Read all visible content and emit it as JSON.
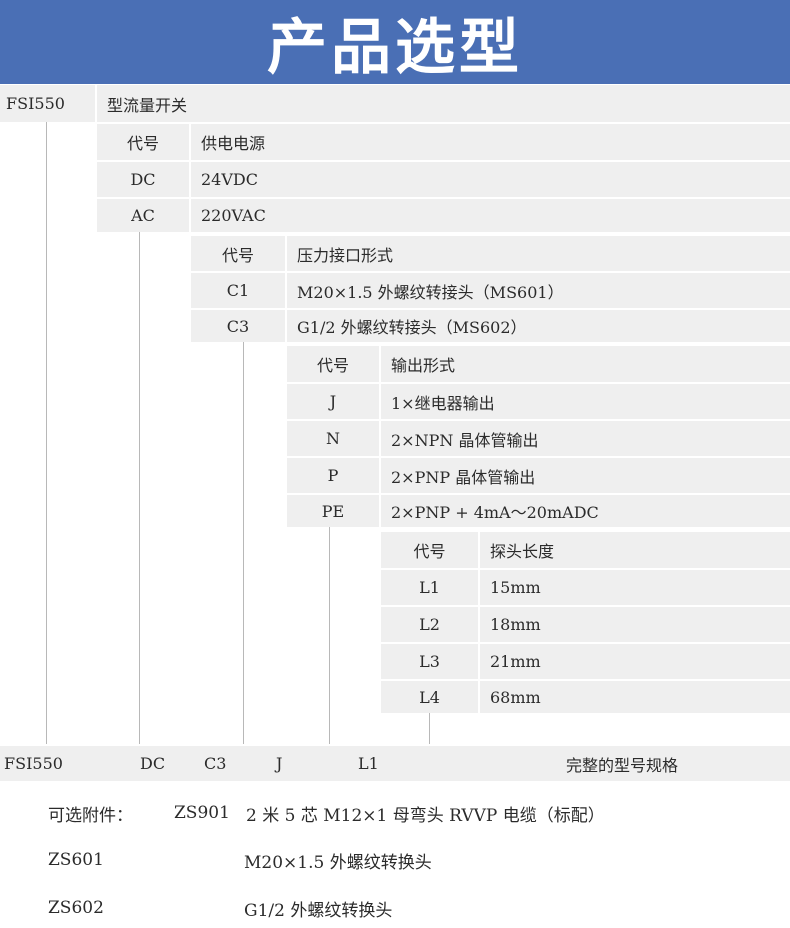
{
  "title": "产品选型",
  "model": {
    "code": "FSI550",
    "name": "型流量开关"
  },
  "power": {
    "header_code": "代号",
    "header_desc": "供电电源",
    "rows": [
      {
        "code": "DC",
        "desc": "24VDC"
      },
      {
        "code": "AC",
        "desc": "220VAC"
      }
    ]
  },
  "pressure": {
    "header_code": "代号",
    "header_desc": "压力接口形式",
    "rows": [
      {
        "code": "C1",
        "desc": "M20×1.5 外螺纹转接头（MS601）"
      },
      {
        "code": "C3",
        "desc": "G1/2 外螺纹转接头（MS602）"
      }
    ]
  },
  "output": {
    "header_code": "代号",
    "header_desc": "输出形式",
    "rows": [
      {
        "code": "J",
        "desc": "1×继电器输出"
      },
      {
        "code": "N",
        "desc": "2×NPN 晶体管输出"
      },
      {
        "code": "P",
        "desc": "2×PNP 晶体管输出"
      },
      {
        "code": "PE",
        "desc": "2×PNP + 4mA～20mADC"
      }
    ]
  },
  "probe": {
    "header_code": "代号",
    "header_desc": "探头长度",
    "rows": [
      {
        "code": "L1",
        "desc": "15mm"
      },
      {
        "code": "L2",
        "desc": "18mm"
      },
      {
        "code": "L3",
        "desc": "21mm"
      },
      {
        "code": "L4",
        "desc": "68mm"
      }
    ]
  },
  "example": {
    "model": "FSI550",
    "power": "DC",
    "pressure": "C3",
    "output": "J",
    "probe": "L1",
    "label": "完整的型号规格"
  },
  "accessories": {
    "label": "可选附件：",
    "items": [
      {
        "code": "ZS901",
        "desc": "2 米 5 芯 M12×1 母弯头 RVVP 电缆（标配）"
      },
      {
        "code": "ZS601",
        "desc": "M20×1.5 外螺纹转换头"
      },
      {
        "code": "ZS602",
        "desc": "G1/2 外螺纹转换头"
      }
    ]
  }
}
